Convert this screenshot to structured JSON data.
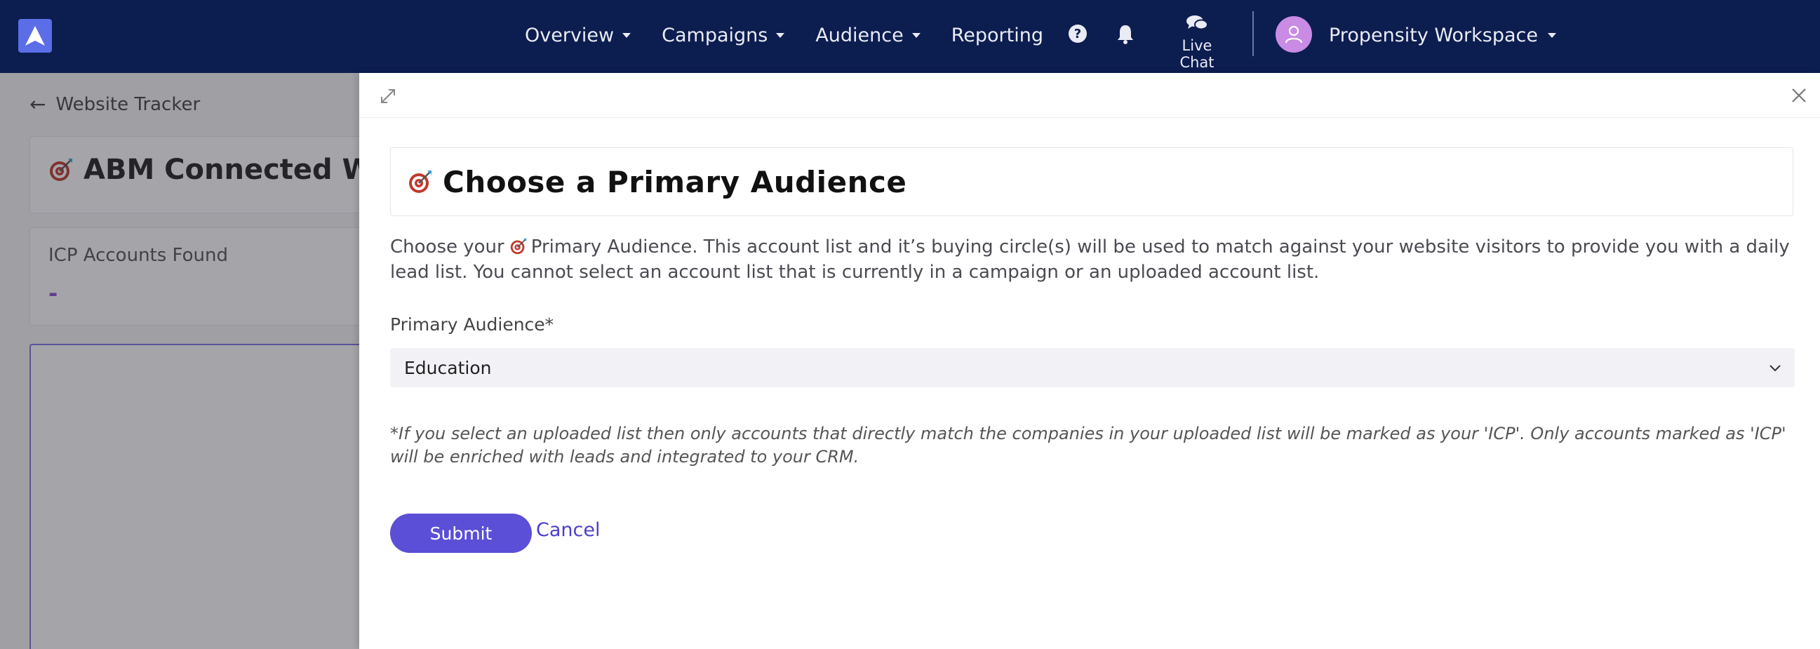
{
  "nav": {
    "items": [
      {
        "label": "Overview",
        "has_caret": true
      },
      {
        "label": "Campaigns",
        "has_caret": true
      },
      {
        "label": "Audience",
        "has_caret": true
      },
      {
        "label": "Reporting",
        "has_caret": false
      }
    ],
    "help_icon": "question-circle-icon",
    "notification_icon": "bell-icon",
    "live_chat_label": "Live Chat",
    "workspace_label": "Propensity Workspace"
  },
  "background_page": {
    "back_link": "Website Tracker",
    "title": "ABM Connected W",
    "stat_label": "ICP Accounts Found",
    "stat_value": "-"
  },
  "drawer": {
    "title": "Choose a Primary Audience",
    "description_before": "Choose your",
    "description_after": "Primary Audience. This account list and it’s buying circle(s) will be used to match against your website visitors to provide you with a daily lead list. You cannot select an account list that is currently in a campaign or an uploaded account list.",
    "field_label": "Primary Audience*",
    "selected_value": "Education",
    "note": "*If you select an uploaded list then only accounts that directly match the companies in your uploaded list will be marked as your 'ICP'. Only accounts marked as 'ICP' will be enriched with leads and integrated to your CRM.",
    "submit_label": "Submit",
    "cancel_label": "Cancel"
  },
  "colors": {
    "nav_bg": "#0c1d4f",
    "accent": "#5a4fd6",
    "avatar": "#c98be3"
  }
}
